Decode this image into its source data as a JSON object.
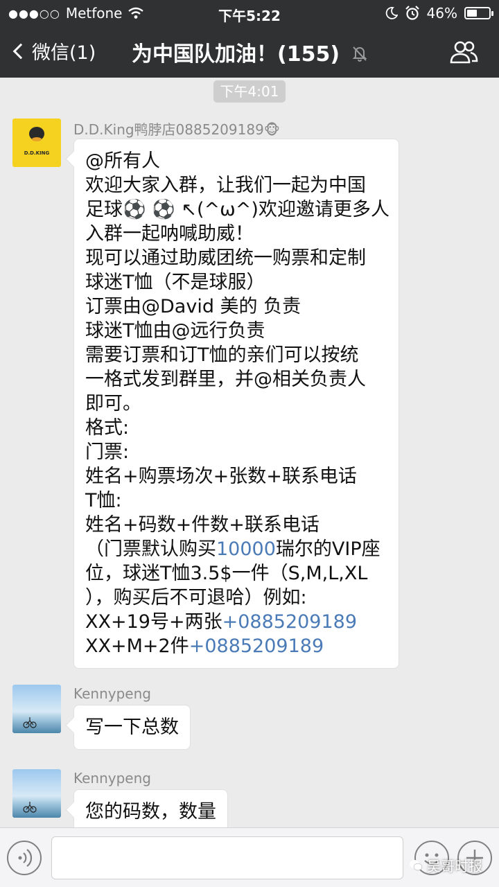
{
  "status_bar": {
    "signal_dots": "●●●○○",
    "carrier": "Metfone",
    "time": "下午5:22",
    "battery_percent": "46%",
    "battery_level": 0.46
  },
  "nav": {
    "back_label": "微信(1)",
    "title": "为中国队加油！(155)",
    "icons": [
      "back-chevron-icon",
      "mute-bell-icon",
      "group-members-icon"
    ]
  },
  "chat": {
    "time_label": "下午4:01",
    "messages": [
      {
        "sender": "D.D.King鸭脖店0885209189🐵",
        "avatar_text": "D.D.KING",
        "lines": [
          "@所有人",
          "欢迎大家入群，让我们一起为中国",
          "足球⚽ ⚽ ↖(^ω^)欢迎邀请更多人",
          "入群一起呐喊助威！",
          "现可以通过助威团统一购票和定制",
          "球迷T恤（不是球服）",
          "订票由@David  美的 负责",
          "球迷T恤由@远行负责",
          "需要订票和订T恤的亲们可以按统",
          "一格式发到群里，并@相关负责人",
          "即可。",
          "格式:",
          "门票:",
          "姓名+购票场次+张数+联系电话",
          "T恤:",
          "姓名+码数+件数+联系电话"
        ],
        "line16": {
          "before": "（门票默认购买",
          "link": "10000",
          "after": "瑞尔的VIP座"
        },
        "line17": "位，球迷T恤3.5$一件（S,M,L,XL",
        "line18": "），购买后不可退哈）例如:",
        "line19": {
          "before": "XX+19号+两张",
          "link": "+0885209189"
        },
        "line20": {
          "before": "XX+M+2件",
          "link": "+0885209189"
        }
      },
      {
        "sender": "Kennypeng",
        "text": "写一下总数"
      },
      {
        "sender": "Kennypeng",
        "text": "您的码数，数量"
      }
    ]
  },
  "input_bar": {
    "icons": [
      "voice-icon",
      "emoji-icon",
      "plus-icon"
    ]
  },
  "watermark": "吴哥时报",
  "colors": {
    "topbar": "#2f3133",
    "chat_bg": "#ebebeb",
    "link": "#4a7bb7",
    "bubble": "#ffffff"
  }
}
